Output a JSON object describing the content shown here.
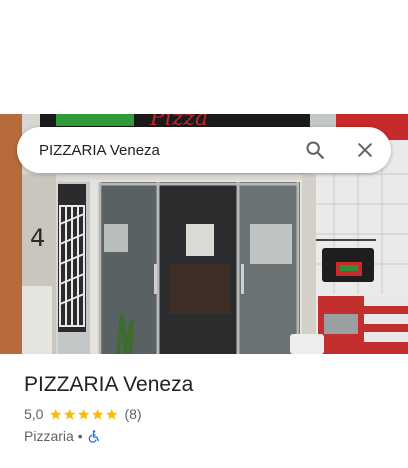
{
  "search": {
    "query": "PIZZARIA Veneza"
  },
  "place": {
    "name": "PIZZARIA Veneza",
    "rating": "5,0",
    "stars": 5,
    "review_count": "(8)",
    "category": "Pizzaria",
    "separator": "•",
    "accessibility_icon": "wheelchair-icon"
  },
  "icons": {
    "search": "search-icon",
    "close": "close-icon",
    "star": "star-icon"
  },
  "colors": {
    "star": "#fbbc04",
    "accessibility": "#1a73e8",
    "title": "#202124",
    "secondary": "#5f6368"
  },
  "photo": {
    "sign_fragment": "Pizza",
    "door_number": "4"
  }
}
